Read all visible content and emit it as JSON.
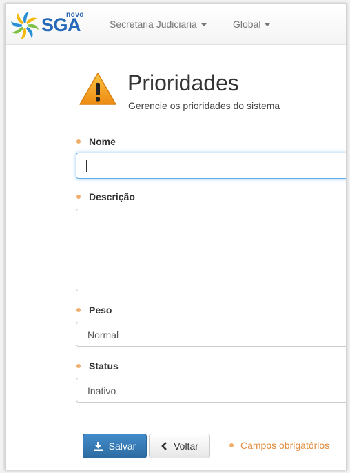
{
  "brand": {
    "name": "SGA",
    "superscript": "novo"
  },
  "nav": {
    "items": [
      {
        "label": "Secretaria Judiciaria"
      },
      {
        "label": "Global"
      }
    ]
  },
  "header": {
    "title": "Prioridades",
    "subtitle": "Gerencie os prioridades do sistema"
  },
  "form": {
    "nome": {
      "label": "Nome",
      "value": ""
    },
    "descricao": {
      "label": "Descrição",
      "value": ""
    },
    "peso": {
      "label": "Peso",
      "value": "Normal"
    },
    "status": {
      "label": "Status",
      "value": "Inativo"
    }
  },
  "actions": {
    "save_label": "Salvar",
    "back_label": "Voltar",
    "required_legend": "Campos obrigatórios"
  },
  "colors": {
    "primary": "#2d6ca2",
    "required_dot": "#f0ad6a",
    "legend_text": "#e08a3c",
    "warning": "#f0a02a"
  }
}
